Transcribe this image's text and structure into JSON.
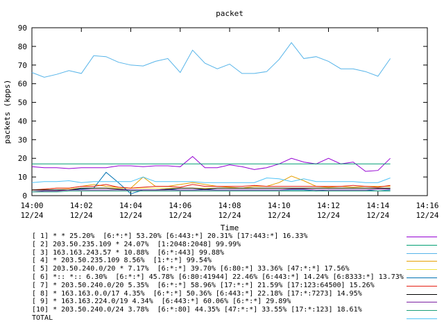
{
  "chart_data": {
    "type": "line",
    "title": "packet",
    "xlabel": "Time",
    "ylabel": "packets (kpps)",
    "xlim": [
      "14:00",
      "14:16"
    ],
    "ylim": [
      0,
      90
    ],
    "y_ticks": [
      0,
      10,
      20,
      30,
      40,
      50,
      60,
      70,
      80,
      90
    ],
    "x_ticks": [
      {
        "time": "14:00",
        "date": "12/24"
      },
      {
        "time": "14:02",
        "date": "12/24"
      },
      {
        "time": "14:04",
        "date": "12/24"
      },
      {
        "time": "14:06",
        "date": "12/24"
      },
      {
        "time": "14:08",
        "date": "12/24"
      },
      {
        "time": "14:10",
        "date": "12/24"
      },
      {
        "time": "14:12",
        "date": "12/24"
      },
      {
        "time": "14:14",
        "date": "12/24"
      },
      {
        "time": "14:16",
        "date": "12/24"
      }
    ],
    "grid": false,
    "legend_placement": "bottom",
    "x": [
      "14:00",
      "14:00:30",
      "14:01",
      "14:01:30",
      "14:02",
      "14:02:30",
      "14:03",
      "14:03:30",
      "14:04",
      "14:04:30",
      "14:05",
      "14:05:30",
      "14:06",
      "14:06:30",
      "14:07",
      "14:07:30",
      "14:08",
      "14:08:30",
      "14:09",
      "14:09:30",
      "14:10",
      "14:10:30",
      "14:11",
      "14:11:30",
      "14:12",
      "14:12:30",
      "14:13",
      "14:13:30",
      "14:14",
      "14:14:30"
    ],
    "series": [
      {
        "name": "[ 1] * * 25.20%  [6:*:*] 53.20% [6:443:*] 20.31% [17:443:*] 16.33%",
        "color": "#9400d3",
        "values": [
          15.5,
          15,
          15,
          14.5,
          15,
          15,
          15,
          16,
          16,
          15.5,
          16,
          16,
          15.5,
          21,
          15,
          15,
          16.5,
          15.5,
          14,
          15,
          17,
          20,
          18,
          17,
          20,
          17,
          18,
          13,
          13.5,
          20
        ]
      },
      {
        "name": "[ 2] 203.50.235.109 * 24.07%  [1:2048:2048] 99.99%",
        "color": "#009e73",
        "values": [
          17,
          17,
          17,
          17,
          17,
          17,
          17,
          17,
          17,
          17,
          17,
          17,
          17,
          17,
          17,
          17,
          17,
          17,
          17,
          17,
          17,
          17,
          17,
          17,
          17,
          17,
          17,
          17,
          17,
          17
        ]
      },
      {
        "name": "[ 3] 163.163.243.57 * 10.88%  [6:*:443] 99.88%",
        "color": "#56b4e9",
        "values": [
          66,
          63.5,
          65,
          67,
          65.5,
          75,
          74.5,
          71.5,
          70,
          69.5,
          72,
          73.5,
          66,
          78,
          71,
          68,
          70.5,
          65.5,
          65.5,
          66.5,
          73,
          82,
          73.5,
          74.5,
          72,
          68,
          68,
          66.5,
          64,
          73.5
        ]
      },
      {
        "name": "[ 4] * 203.50.235.109 8.56%  [1:*:*] 99.54%",
        "color": "#e69f00",
        "values": [
          3,
          3.5,
          4,
          4,
          5,
          6,
          5,
          4.5,
          4,
          10,
          5,
          5,
          6,
          7,
          6,
          5,
          4.5,
          4,
          5,
          5,
          7,
          10.5,
          8,
          5,
          4.5,
          5,
          4.5,
          5,
          5,
          5
        ]
      },
      {
        "name": "[ 5] 203.50.240.0/20 * 7.17%  [6:*:*] 39.70% [6:80:*] 33.36% [47:*:*] 17.56%",
        "color": "#f0e442",
        "values": [
          3,
          3,
          3,
          3.5,
          4,
          4,
          4,
          4,
          4,
          4,
          4,
          4,
          4,
          4,
          4,
          4,
          4,
          4,
          4,
          4,
          4,
          4,
          4,
          4,
          4,
          4,
          4,
          4,
          4,
          4
        ]
      },
      {
        "name": "[ 6] *:: *:: 6.30%  [6:*:*] 45.78% [6:80:41944] 22.46% [6:443:*] 14.24% [6:8333:*] 13.73%",
        "color": "#0072b2",
        "values": [
          3,
          3,
          3,
          3,
          3.5,
          4,
          12.5,
          7,
          1,
          3,
          3,
          3.5,
          3,
          3,
          3.5,
          3,
          3,
          3,
          3,
          3,
          3,
          3,
          3,
          2.5,
          3,
          3,
          3,
          3,
          2.5,
          3
        ]
      },
      {
        "name": "[ 7] * 203.50.240.0/20 5.35%  [6:*:*] 58.96% [17:*:*] 21.59% [17:123:64500] 15.26%",
        "color": "#e51e10",
        "values": [
          3,
          3.5,
          4,
          4,
          5,
          5,
          6,
          4.5,
          4,
          4.5,
          5,
          5,
          4.5,
          6,
          5,
          5,
          5,
          5,
          5.5,
          5,
          5,
          5,
          5,
          5,
          5,
          5,
          5.5,
          5,
          4.5,
          5.5
        ]
      },
      {
        "name": "[ 8] * 163.163.0.0/17 4.35%  [6:*:*] 50.36% [6:443:*] 22.18% [17:*:7273] 14.95%",
        "color": "#000000",
        "values": [
          3,
          3,
          3,
          3,
          4,
          4,
          4,
          3.5,
          3,
          3,
          3,
          3.5,
          4,
          4,
          3.5,
          4,
          4,
          4,
          4,
          4,
          4,
          4,
          4,
          4,
          4,
          4,
          4,
          4,
          4,
          4
        ]
      },
      {
        "name": "[ 9] * 163.163.224.0/19 4.34%  [6:443:*] 60.06% [6:*:*] 29.89%",
        "color": "#7a1fa2",
        "values": [
          2,
          2.5,
          2.5,
          3,
          3,
          3,
          3,
          3,
          3,
          3,
          3,
          3,
          3,
          3,
          3,
          3,
          3,
          3,
          3,
          3,
          3,
          3.5,
          3.5,
          3,
          3,
          3,
          3,
          3,
          3.5,
          3.5
        ]
      },
      {
        "name": "[10] * 203.50.240.0/24 3.78%  [6:*:80] 44.35% [47:*:*] 33.55% [17:*:123] 18.61%",
        "color": "#1b9e77",
        "values": [
          2,
          2,
          2,
          2.5,
          2.5,
          2.5,
          2.5,
          2.5,
          2.5,
          2.5,
          2.5,
          2.5,
          2.5,
          2.5,
          2.5,
          2.5,
          2.5,
          2.5,
          2.5,
          2.5,
          2.5,
          2.5,
          2.5,
          2.5,
          2.5,
          2.5,
          2.5,
          2.5,
          2.5,
          2.5
        ]
      },
      {
        "name": "TOTAL",
        "color": "#4fc3f7",
        "values": [
          7,
          7.5,
          7.5,
          8,
          7,
          7.5,
          7.5,
          7.5,
          7.5,
          10,
          7.5,
          7.5,
          7.5,
          7.5,
          7,
          7,
          7,
          7,
          7,
          9.5,
          9,
          7.5,
          9,
          7.5,
          7.5,
          7.5,
          7.5,
          7,
          7,
          9.5
        ]
      }
    ]
  }
}
